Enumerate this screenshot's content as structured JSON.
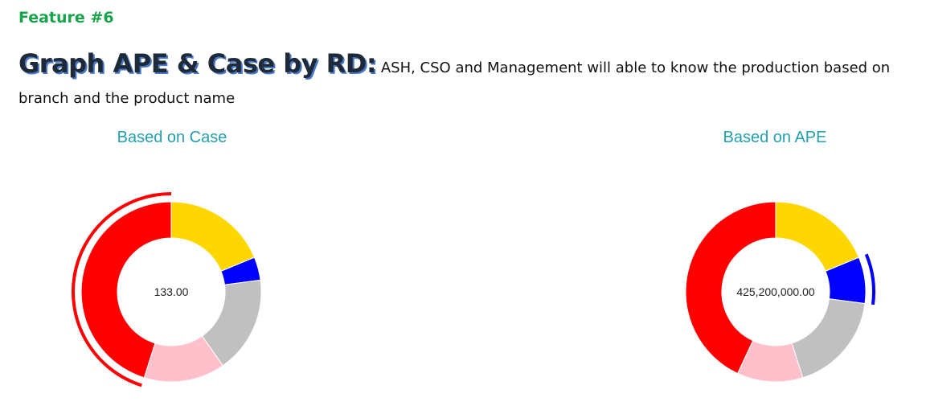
{
  "feature_label": "Feature #6",
  "heading": {
    "title": "Graph APE & Case by RD:",
    "description": "ASH, CSO and Management will able to know the production based on branch and the product name"
  },
  "chart_data": [
    {
      "type": "pie",
      "title": "Based on Case",
      "subtitle": "",
      "center_label": "133.00",
      "donut": true,
      "slices": [
        {
          "color": "#FFD700",
          "value": 0.1875
        },
        {
          "color": "#0000FF",
          "value": 0.0417
        },
        {
          "color": "#C0C0C0",
          "value": 0.1736
        },
        {
          "color": "#FFC0CB",
          "value": 0.1458
        },
        {
          "color": "#FF0000",
          "value": 0.4514
        }
      ],
      "highlighted_slice": 4
    },
    {
      "type": "pie",
      "title": "Based on APE",
      "subtitle": "",
      "center_label": "425,200,000.00",
      "donut": true,
      "slices": [
        {
          "color": "#FFD700",
          "value": 0.1875
        },
        {
          "color": "#0000FF",
          "value": 0.0833
        },
        {
          "color": "#C0C0C0",
          "value": 0.1806
        },
        {
          "color": "#FFC0CB",
          "value": 0.1181
        },
        {
          "color": "#FF0000",
          "value": 0.4305
        }
      ],
      "highlighted_slice": 1
    }
  ]
}
